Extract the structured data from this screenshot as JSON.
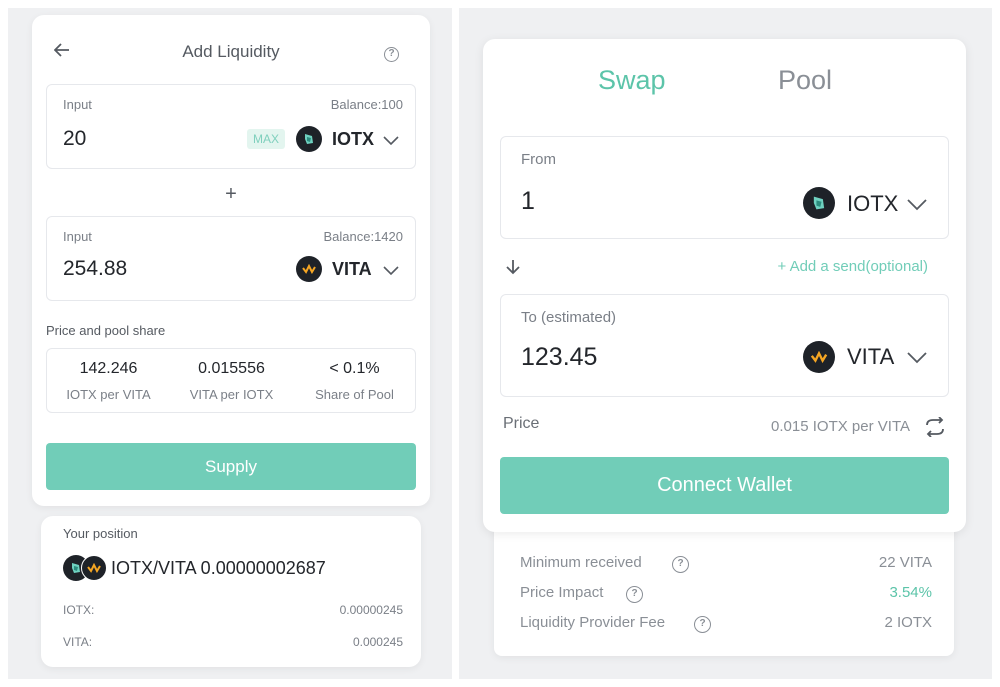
{
  "add_liquidity": {
    "title": "Add Liquidity",
    "input1": {
      "label": "Input",
      "balance": "Balance:100",
      "value": "20",
      "max_label": "MAX",
      "token": "IOTX"
    },
    "plus": "+",
    "input2": {
      "label": "Input",
      "balance": "Balance:1420",
      "value": "254.88",
      "token": "VITA"
    },
    "price_share_label": "Price and pool share",
    "stats": [
      {
        "value": "142.246",
        "label": "IOTX per VITA"
      },
      {
        "value": "0.015556",
        "label": "VITA per IOTX"
      },
      {
        "value": "< 0.1%",
        "label": "Share of Pool"
      }
    ],
    "supply_label": "Supply"
  },
  "position": {
    "title": "Your position",
    "pair": "IOTX/VITA 0.00000002687",
    "rows": [
      {
        "label": "IOTX:",
        "value": "0.00000245"
      },
      {
        "label": "VITA:",
        "value": "0.000245"
      }
    ]
  },
  "swap": {
    "tabs": [
      {
        "label": "Swap",
        "active": true
      },
      {
        "label": "Pool",
        "active": false
      }
    ],
    "from": {
      "label": "From",
      "value": "1",
      "token": "IOTX"
    },
    "add_send": "+ Add a send(optional)",
    "to": {
      "label": "To (estimated)",
      "value": "123.45",
      "token": "VITA"
    },
    "price_label": "Price",
    "price_value": "0.015 IOTX per VITA",
    "connect_label": "Connect Wallet"
  },
  "details": [
    {
      "label": "Minimum received",
      "value": "22 VITA",
      "color": "#8a8f96"
    },
    {
      "label": "Price Impact",
      "value": "3.54%",
      "color": "#5cc4a9"
    },
    {
      "label": "Liquidity Provider Fee",
      "value": "2 IOTX",
      "color": "#8a8f96"
    }
  ],
  "colors": {
    "accent": "#71cdb8",
    "accent_text": "#5cc4a9",
    "panel_bg": "#eff0f2",
    "token_bg": "#1e2228"
  },
  "icons": [
    "back-arrow-icon",
    "help-icon",
    "iotx-logo-icon",
    "vita-logo-icon",
    "chevron-down-icon",
    "down-arrow-icon",
    "swap-price-icon"
  ]
}
